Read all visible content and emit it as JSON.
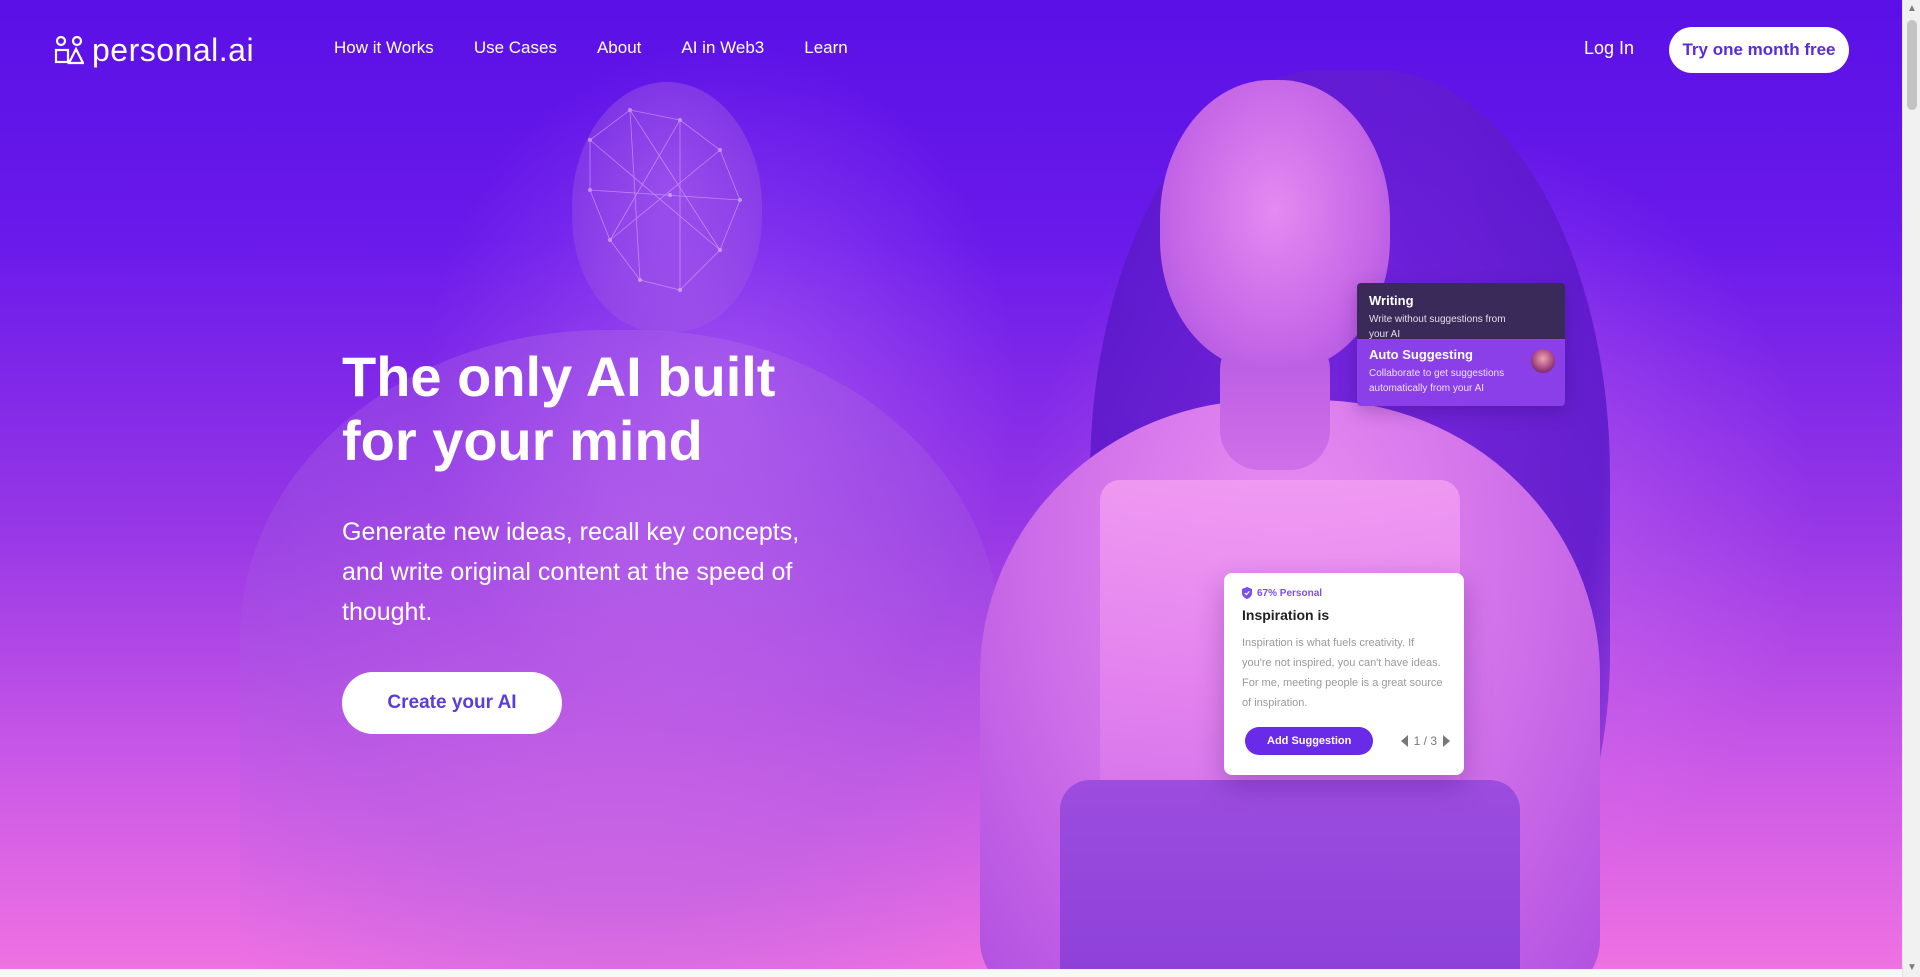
{
  "brand": {
    "name": "personal.ai"
  },
  "nav": {
    "links": [
      "How it Works",
      "Use Cases",
      "About",
      "AI in Web3",
      "Learn"
    ],
    "login": "Log In",
    "cta": "Try one month free"
  },
  "hero": {
    "title": "The only AI built for your mind",
    "subtitle": "Generate new ideas, recall key concepts, and write original content at the speed of thought.",
    "cta": "Create your AI"
  },
  "mode_card": {
    "writing_title": "Writing",
    "writing_desc": "Write without suggestions from your AI",
    "auto_title": "Auto Suggesting",
    "auto_desc": "Collaborate to get suggestions automatically from your AI"
  },
  "inspiration_card": {
    "badge": "67% Personal",
    "title": "Inspiration is",
    "body": "Inspiration is what fuels creativity. If you're not inspired, you can't have ideas. For me, meeting people is a great source of inspiration.",
    "button": "Add Suggestion",
    "pager": "1 / 3"
  },
  "icons": {
    "logo": "personal-ai-logo-icon",
    "shield": "shield-icon",
    "prev": "chevron-left-icon",
    "next": "chevron-right-icon",
    "scroll_up": "scroll-up-icon",
    "scroll_down": "scroll-down-icon"
  },
  "colors": {
    "bg_top": "#5a10e6",
    "bg_bottom": "#ef72e2",
    "accent": "#6a2be8",
    "button_text": "#5b3cdc"
  }
}
